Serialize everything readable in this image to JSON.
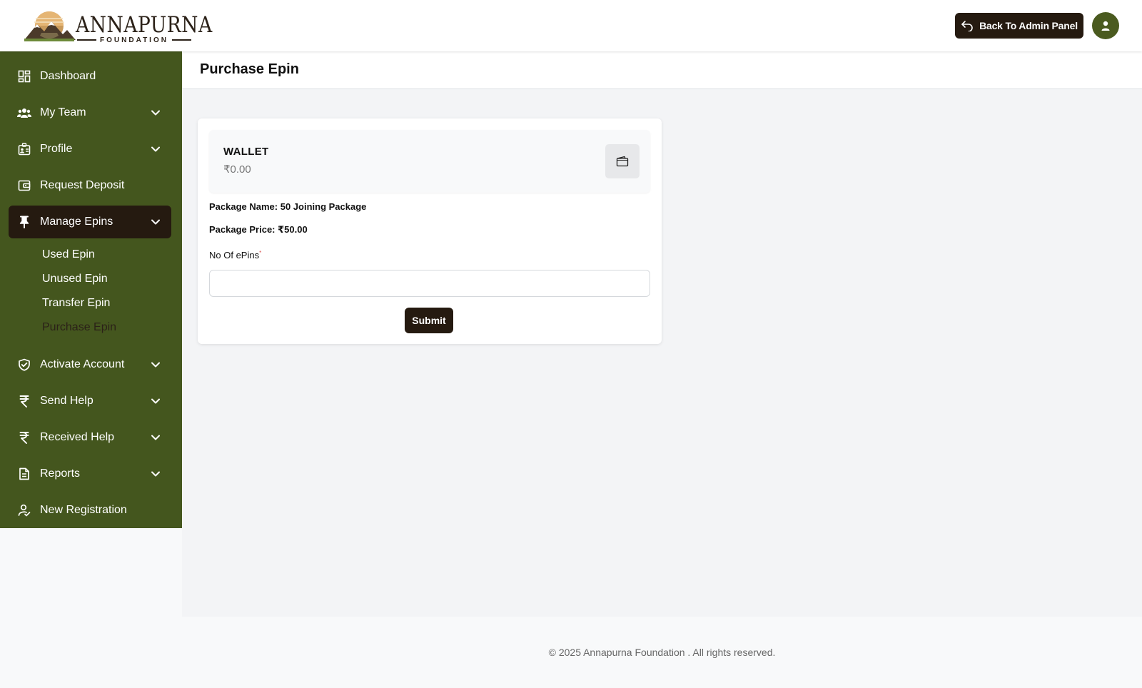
{
  "brand": {
    "name": "ANNAPURNA",
    "subtitle": "FOUNDATION"
  },
  "header": {
    "admin_button_label": "Back To Admin Panel"
  },
  "sidebar": {
    "items": [
      {
        "label": "Dashboard",
        "icon": "dashboard-icon",
        "has_chevron": false
      },
      {
        "label": "My Team",
        "icon": "team-icon",
        "has_chevron": true
      },
      {
        "label": "Profile",
        "icon": "profile-icon",
        "has_chevron": true
      },
      {
        "label": "Request Deposit",
        "icon": "wallet-icon",
        "has_chevron": false
      },
      {
        "label": "Manage Epins",
        "icon": "pin-icon",
        "has_chevron": true,
        "active": true
      },
      {
        "label": "Activate Account",
        "icon": "shield-check-icon",
        "has_chevron": true
      },
      {
        "label": "Send Help",
        "icon": "rupee-icon",
        "has_chevron": true
      },
      {
        "label": "Received Help",
        "icon": "rupee-icon",
        "has_chevron": true
      },
      {
        "label": "Reports",
        "icon": "document-icon",
        "has_chevron": true
      },
      {
        "label": "New Registration",
        "icon": "add-user-icon",
        "has_chevron": false
      }
    ],
    "subitems": [
      {
        "label": "Used Epin"
      },
      {
        "label": "Unused Epin"
      },
      {
        "label": "Transfer Epin"
      },
      {
        "label": "Purchase Epin",
        "current": true
      }
    ]
  },
  "page": {
    "title": "Purchase Epin"
  },
  "wallet": {
    "title": "WALLET",
    "amount": "₹0.00"
  },
  "package": {
    "name_line": "Package Name: 50 Joining Package",
    "price_line": "Package Price: ₹50.00"
  },
  "form": {
    "field_label": "No Of ePins",
    "required_mark": "*",
    "value": "",
    "submit_label": "Submit"
  },
  "footer": {
    "text": "© 2025 Annapurna Foundation . All rights reserved."
  },
  "colors": {
    "sidebar_bg": "#44561e",
    "dark_accent": "#251a10",
    "content_bg": "#f3f4f6"
  }
}
